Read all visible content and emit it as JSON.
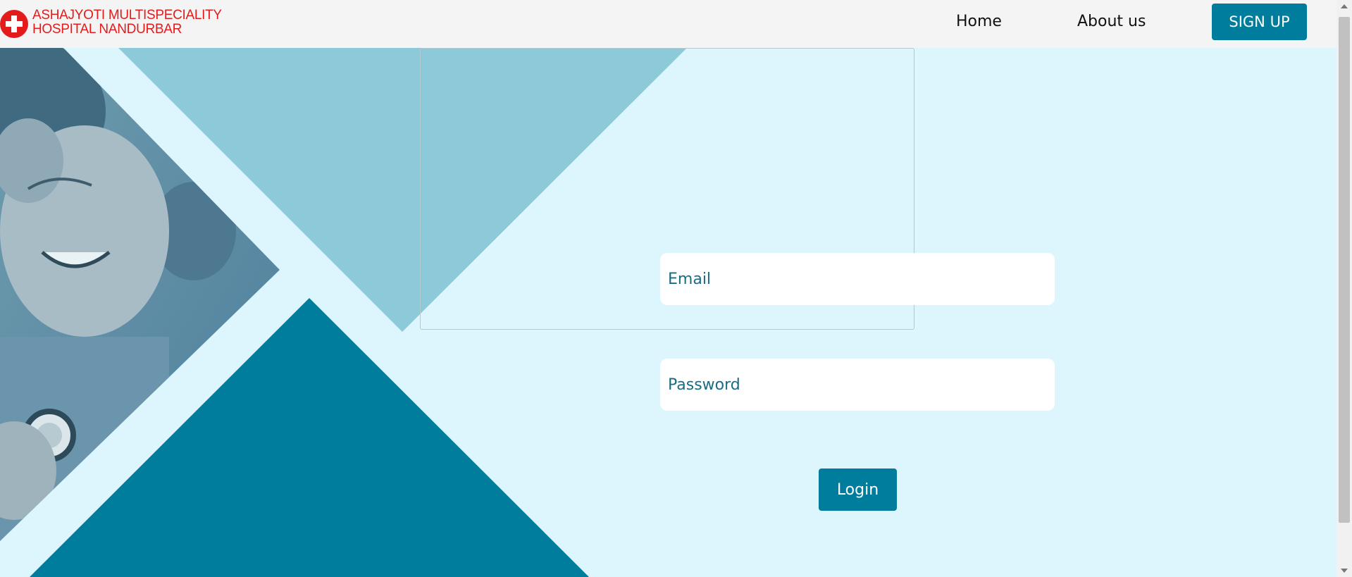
{
  "brand": {
    "name_line1": "ASHAJYOTI MULTISPECIALITY",
    "name_line2": "HOSPITAL NANDURBAR",
    "logo_icon": "red-cross-icon",
    "color": "#e41b1b"
  },
  "nav": {
    "home": "Home",
    "about": "About us",
    "signup": "SIGN UP"
  },
  "form": {
    "email_placeholder": "Email",
    "password_placeholder": "Password",
    "login_label": "Login"
  },
  "colors": {
    "accent": "#007c9c",
    "background": "#ddf6fd",
    "decor_light": "#8ccad9"
  }
}
